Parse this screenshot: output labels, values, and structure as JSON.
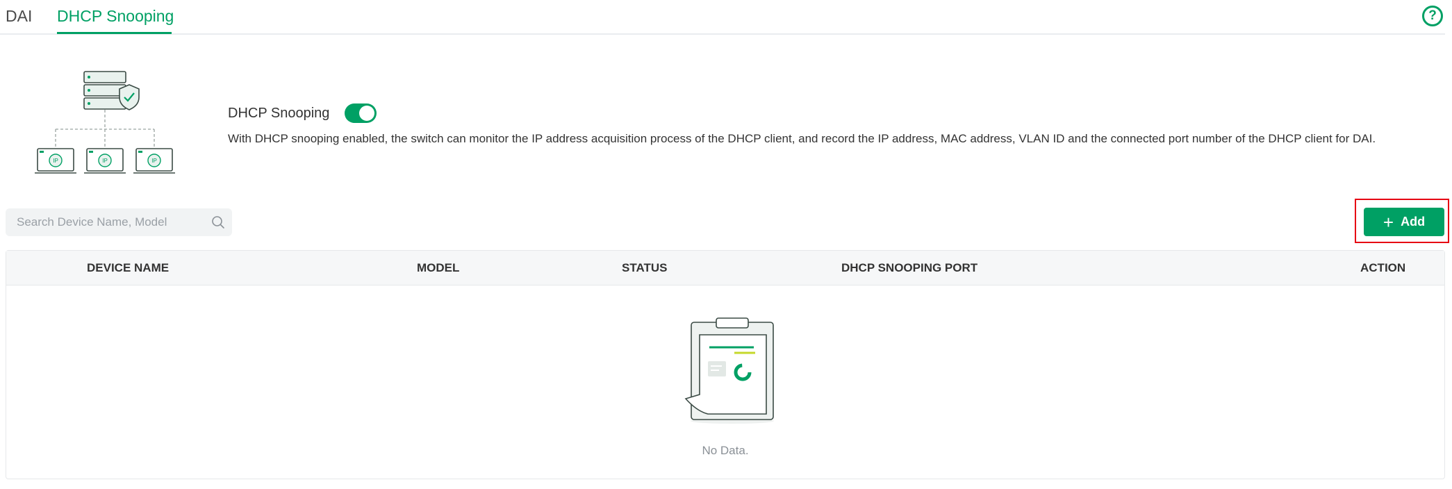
{
  "tabs": [
    {
      "label": "DAI",
      "active": false
    },
    {
      "label": "DHCP Snooping",
      "active": true
    }
  ],
  "help": {
    "icon": "help-circle-icon",
    "glyph": "?"
  },
  "feature": {
    "title": "DHCP Snooping",
    "enabled": true,
    "description": "With DHCP snooping enabled, the switch can monitor the IP address acquisition process of the DHCP client, and record the IP address, MAC address, VLAN ID and the connected port number of the DHCP client for DAI.",
    "illustration": {
      "icon": "dhcp-snooping-network-illustration",
      "client_label": "IP"
    }
  },
  "search": {
    "placeholder": "Search Device Name, Model",
    "value": "",
    "icon": "search-icon"
  },
  "add_button": {
    "label": "Add",
    "icon": "plus-icon",
    "glyph": "+"
  },
  "table": {
    "columns": [
      "DEVICE NAME",
      "MODEL",
      "STATUS",
      "DHCP SNOOPING PORT",
      "ACTION"
    ],
    "rows": [],
    "empty_text": "No Data.",
    "empty_icon": "empty-clipboard-icon"
  },
  "colors": {
    "accent": "#00a064",
    "highlight_border": "#e60012",
    "header_bg": "#f6f7f8",
    "search_bg": "#f1f3f4"
  }
}
